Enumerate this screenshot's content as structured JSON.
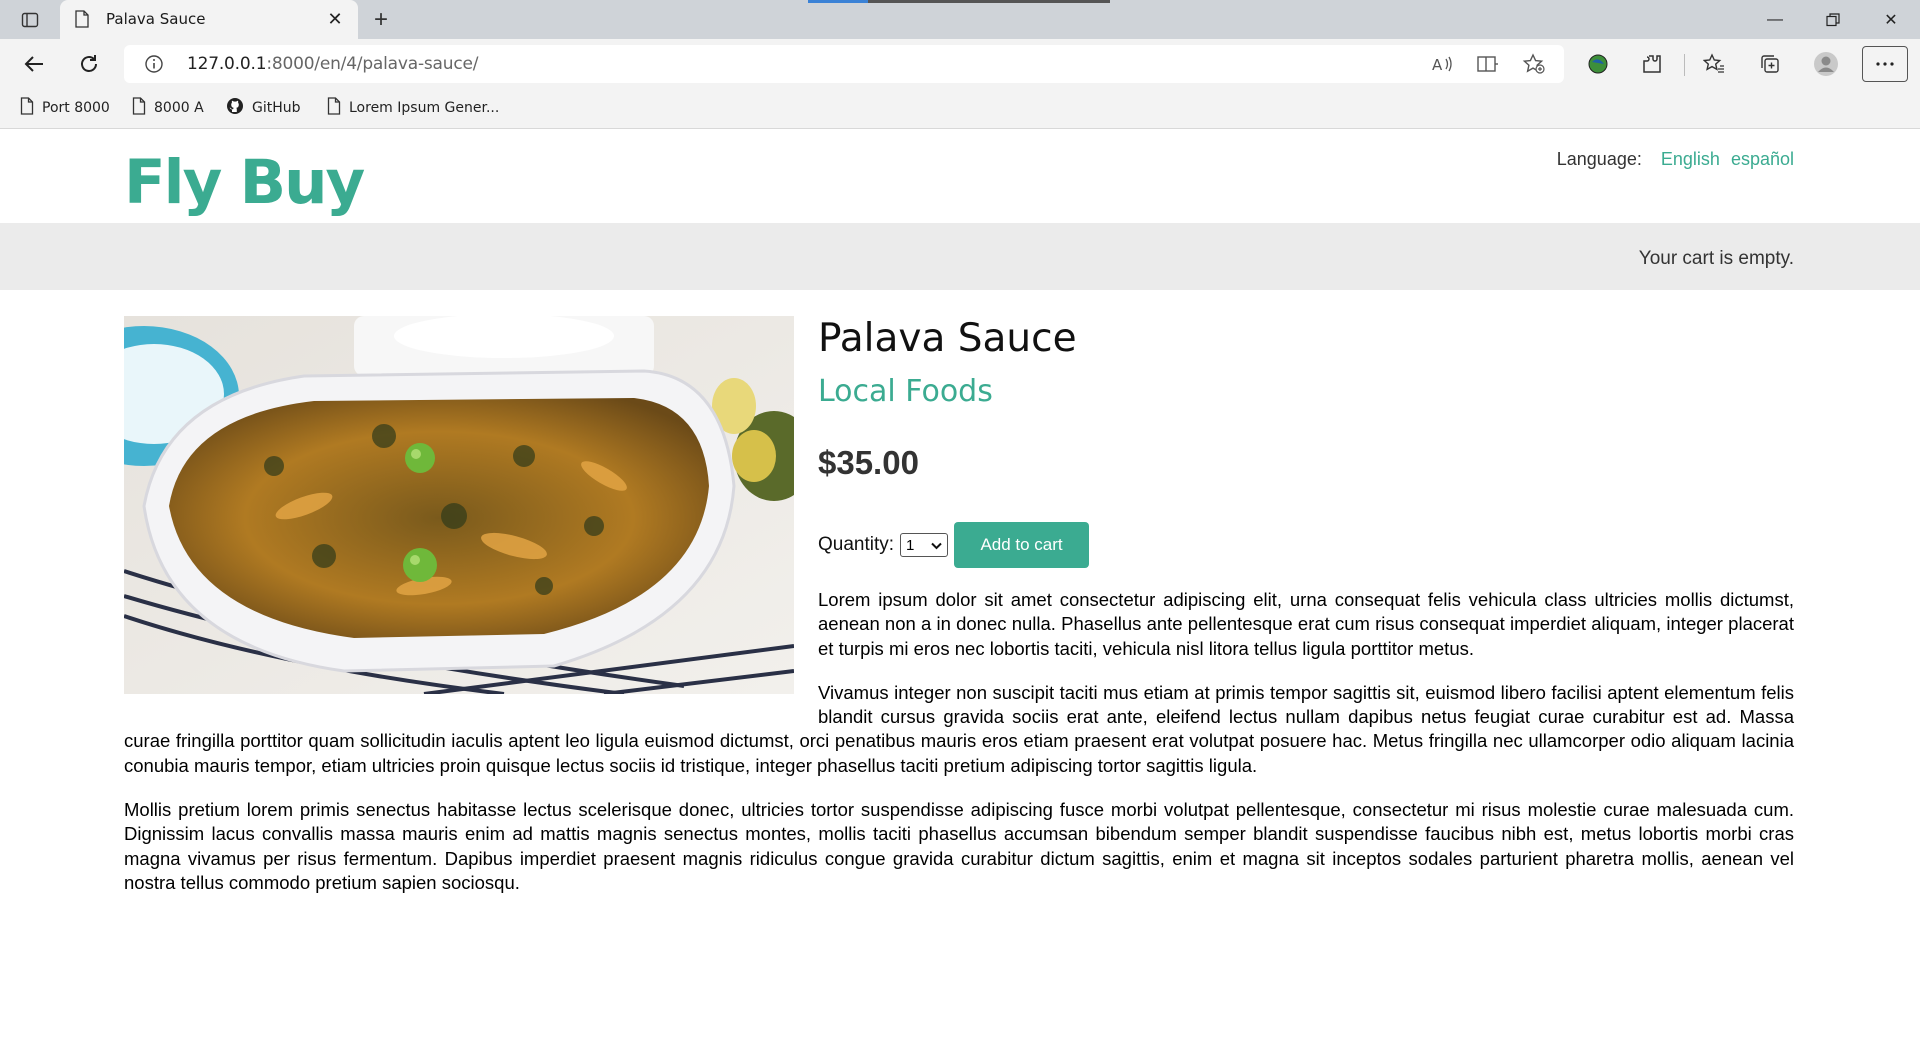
{
  "browser": {
    "tab_title": "Palava Sauce",
    "url_host": "127.0.0.1",
    "url_path": ":8000/en/4/palava-sauce/",
    "bookmarks": [
      {
        "label": "Port 8000",
        "icon": "page-icon"
      },
      {
        "label": "8000 A",
        "icon": "page-icon"
      },
      {
        "label": "GitHub",
        "icon": "github-icon"
      },
      {
        "label": "Lorem Ipsum Gener...",
        "icon": "page-icon"
      }
    ]
  },
  "site": {
    "logo": "Fly Buy",
    "language_label": "Language:",
    "languages": [
      "English",
      "español"
    ],
    "cart_status": "Your cart is empty."
  },
  "product": {
    "name": "Palava Sauce",
    "category": "Local Foods",
    "price": "$35.00",
    "quantity_label": "Quantity:",
    "quantity_value": "1",
    "add_to_cart": "Add to cart",
    "image_alt": "bowl of palava sauce",
    "description": [
      "Lorem ipsum dolor sit amet consectetur adipiscing elit, urna consequat felis vehicula class ultricies mollis dictumst, aenean non a in donec nulla. Phasellus ante pellentesque erat cum risus consequat imperdiet aliquam, integer placerat et turpis mi eros nec lobortis taciti, vehicula nisl litora tellus ligula porttitor metus.",
      "Vivamus integer non suscipit taciti mus etiam at primis tempor sagittis sit, euismod libero facilisi aptent elementum felis blandit cursus gravida sociis erat ante, eleifend lectus nullam dapibus netus feugiat curae curabitur est ad. Massa curae fringilla porttitor quam sollicitudin iaculis aptent leo ligula euismod dictumst, orci penatibus mauris eros etiam praesent erat volutpat posuere hac. Metus fringilla nec ullamcorper odio aliquam lacinia conubia mauris tempor, etiam ultricies proin quisque lectus sociis id tristique, integer phasellus taciti pretium adipiscing tortor sagittis ligula.",
      "Mollis pretium lorem primis senectus habitasse lectus scelerisque donec, ultricies tortor suspendisse adipiscing fusce morbi volutpat pellentesque, consectetur mi risus molestie curae malesuada cum. Dignissim lacus convallis massa mauris enim ad mattis magnis senectus montes, mollis taciti phasellus accumsan bibendum semper blandit suspendisse faucibus nibh est, metus lobortis morbi cras magna vivamus per risus fermentum. Dapibus imperdiet praesent magnis ridiculus congue gravida curabitur dictum sagittis, enim et magna sit inceptos sodales parturient pharetra mollis, aenean vel nostra tellus commodo pretium sapien sociosqu."
    ]
  },
  "colors": {
    "accent": "#3bab91",
    "cart_bar": "#ebebeb"
  }
}
